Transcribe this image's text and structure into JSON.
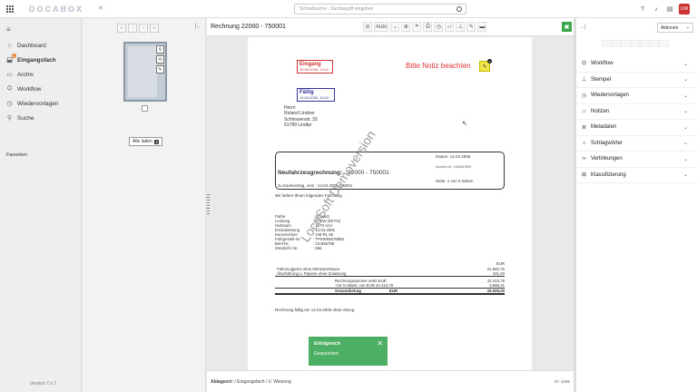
{
  "app": {
    "logo": "DOCABOX",
    "search_placeholder": "Schnellsuche - Suchbegriff eingeben",
    "user_initials": "UW"
  },
  "sidebar": {
    "items": [
      {
        "label": "Dashboard",
        "icon": "home-icon"
      },
      {
        "label": "Eingangsfach",
        "icon": "inbox-icon",
        "badge": "1"
      },
      {
        "label": "Archiv",
        "icon": "archive-icon"
      },
      {
        "label": "Workflow",
        "icon": "workflow-icon"
      },
      {
        "label": "Wiedervorlagen",
        "icon": "clock-icon"
      },
      {
        "label": "Suche",
        "icon": "search-icon"
      }
    ],
    "favorites_label": "Favoriten",
    "version": "Version 7.x.7"
  },
  "thumbs": {
    "load_all_label": "Alle laden",
    "load_all_count": "1"
  },
  "viewer": {
    "title": "Rechnung 22000 - 750001",
    "zoom": "Auto",
    "stamp_received": {
      "title": "Eingang",
      "date": "18.05.2005, 14:12"
    },
    "stamp_due": {
      "title": "Fällig",
      "date": "14.06.2005, 14:13"
    },
    "notice": "Bitte Notiz beachten",
    "note_count": "1",
    "address": [
      "Herrn",
      "Roland Lindner",
      "Schlossenstr. 33",
      "51789 Lindlar"
    ],
    "invoice": {
      "date": "Datum: 14.04.2005",
      "customer": "Kunden-Nr.: 1024567890",
      "title": "Neufahrzeugrechnung:",
      "number": "22000 - 750001",
      "page_label": "Seite:",
      "page": "1 von 2 Seiten",
      "contract": "zu Kaufvertrag, vom : 14.04.2005 .N5001"
    },
    "intro": "Wir liefern Ihnen folgendes Fahrzeug",
    "specs": [
      [
        "Farbe",
        ": schwarz"
      ],
      [
        "Leistung",
        ": 37 kW   (50 PS)"
      ],
      [
        "Hubraum",
        ": 1573 ccm"
      ],
      [
        "Erstzulassung",
        ": 14.04.2005"
      ],
      [
        "Kennzeichen",
        ": GM-RL 66"
      ],
      [
        "Fahrgestell-Nr.",
        ": TPSW65678955"
      ],
      [
        "Brief-Nr.",
        ": GC656788"
      ],
      [
        "Zündschl.-Nr.",
        ": 666"
      ]
    ],
    "costs_currency": "EUR",
    "costs": [
      {
        "label": "Fahrzeugpreis ohne Mehrwertsteuer",
        "value": "21.982,76"
      },
      {
        "label": "Überführung u. Papiere ohne Zulassung",
        "value": "431,03"
      },
      {
        "label": "Rechnungssumme netto   EUR",
        "value": "22.413,79"
      },
      {
        "label": "+16 % MwSt. von            EUR   22.413,79",
        "value": "3.586,21"
      }
    ],
    "total_label": "Gesamtbetrag",
    "total_currency": "EUR",
    "total_value": "26.000,00",
    "due_text": "Rechnung fällig am 14.04.2005 ohne Abzug",
    "watermark": "LocoSoft Demoversion"
  },
  "toast": {
    "title": "Erfolgreich",
    "message": "Gespeichert"
  },
  "footer": {
    "breadcrumb_label": "Ablageort:",
    "path": [
      "Eingangsfach",
      "V. Wiesong"
    ],
    "doc_id": "ID: 4296"
  },
  "rightpanel": {
    "select_value": "Aktionen",
    "sections": [
      {
        "label": "Workflow",
        "icon": "workflow-icon"
      },
      {
        "label": "Stempel",
        "icon": "stamp-icon"
      },
      {
        "label": "Wiedervorlagen",
        "icon": "clock-icon"
      },
      {
        "label": "Notizen",
        "icon": "note-icon"
      },
      {
        "label": "Metadaten",
        "icon": "database-icon"
      },
      {
        "label": "Schlagwörter",
        "icon": "tag-icon"
      },
      {
        "label": "Verlinkungen",
        "icon": "link-icon"
      },
      {
        "label": "Klassifizierung",
        "icon": "tree-icon"
      }
    ]
  }
}
